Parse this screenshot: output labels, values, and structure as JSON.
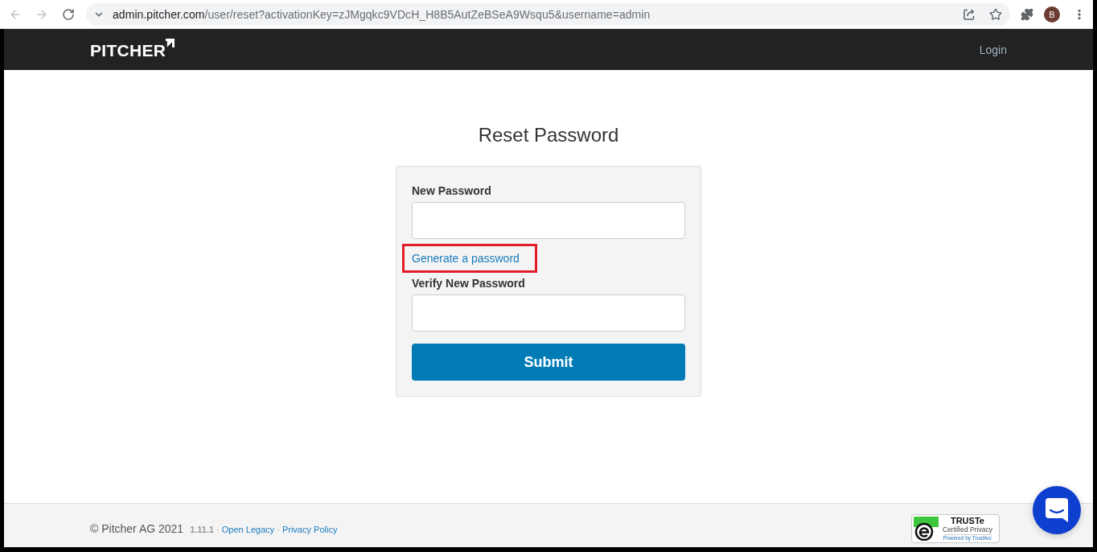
{
  "browser": {
    "nav_buttons": [
      {
        "kind": "back",
        "disabled": true
      },
      {
        "kind": "forward",
        "disabled": true
      },
      {
        "kind": "reload",
        "disabled": false
      }
    ],
    "url": {
      "host": "admin.pitcher.com",
      "path": "/user/reset?activationKey=zJMgqkc9VDcH_H8B5AutZeBSeA9Wsqu5&username=admin"
    },
    "profile_initial": "B"
  },
  "header": {
    "logo": "PITCHER",
    "nav_link": "Login"
  },
  "page": {
    "title": "Reset Password"
  },
  "form": {
    "fields": [
      {
        "label": "New Password"
      },
      {
        "label": "Verify New Password"
      }
    ],
    "generate_link": {
      "label": "Generate a password",
      "highlighted": true
    },
    "submit": "Submit"
  },
  "footer": {
    "copyright": "© Pitcher AG 2021",
    "items": [
      {
        "kind": "version",
        "text": "1.11.1"
      },
      {
        "kind": "separator",
        "text": "·"
      },
      {
        "kind": "link",
        "text": "Open Legacy"
      },
      {
        "kind": "separator",
        "text": "·"
      },
      {
        "kind": "link",
        "text": "Privacy Policy"
      }
    ],
    "badge": {
      "title": "TRUSTe",
      "subtitle": "Certified Privacy",
      "powered_by": "Powered by TrustArc"
    }
  }
}
